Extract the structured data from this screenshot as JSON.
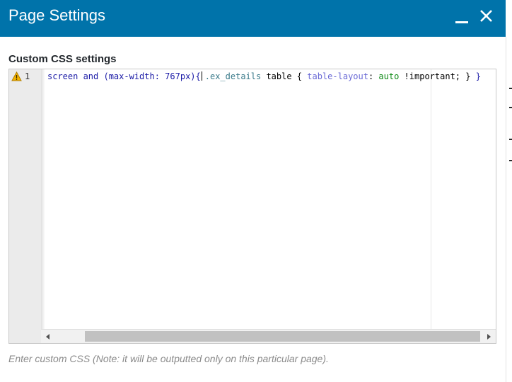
{
  "dialog": {
    "title": "Page Settings",
    "title_bar_color": "#0073aa"
  },
  "icons": {
    "minimize": "minimize-icon",
    "close": "close-icon",
    "warning": "warning-icon",
    "scroll_left": "arrow-left-icon",
    "scroll_right": "arrow-right-icon"
  },
  "section": {
    "label": "Custom CSS settings"
  },
  "editor": {
    "line_number": "1",
    "tokens": {
      "t1": "screen and (max-width: 767px)",
      "t2": "{",
      "t3": ".ex_details",
      "t4": " table { ",
      "t5": "table-layout",
      "t6": ": ",
      "t7": "auto",
      "t8": " !important; } ",
      "t9": "}"
    }
  },
  "help": {
    "text": "Enter custom CSS (Note: it will be outputted only on this particular page)."
  }
}
